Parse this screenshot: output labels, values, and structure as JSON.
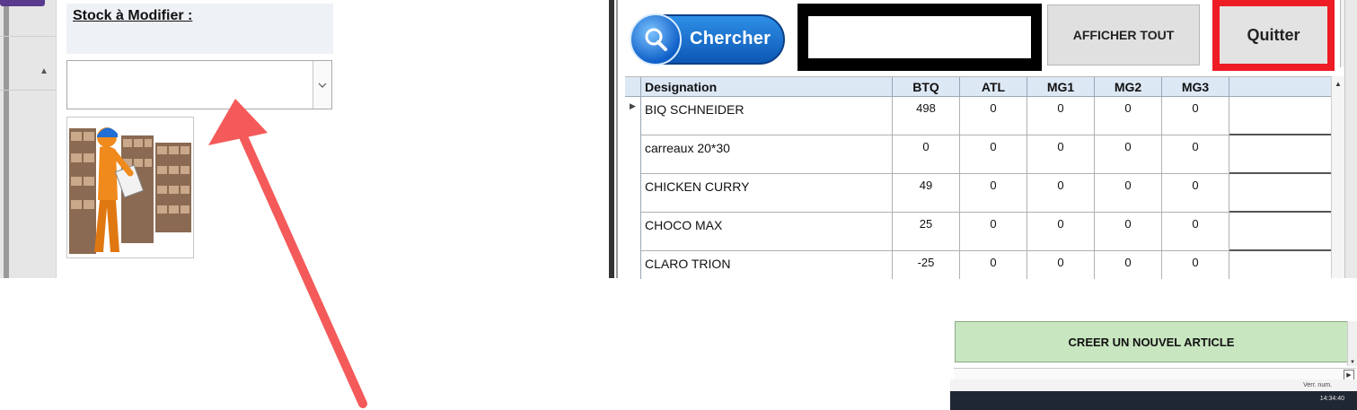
{
  "left_panel": {
    "stock_label": "Stock à Modifier :",
    "combo_value": "",
    "image_icon": "warehouse-worker-clipboard-image"
  },
  "toolbar": {
    "search_label": "Chercher",
    "search_icon": "magnifier-icon",
    "search_value": "",
    "show_all_label": "AFFICHER TOUT",
    "quit_label": "Quitter",
    "accent_blue": "#0d57b5",
    "quit_border": "#ee1c24"
  },
  "grid": {
    "columns": [
      "Designation",
      "BTQ",
      "ATL",
      "MG1",
      "MG2",
      "MG3"
    ],
    "rows": [
      {
        "designation": "BIQ SCHNEIDER",
        "btq": "498",
        "atl": "0",
        "mg1": "0",
        "mg2": "0",
        "mg3": "0"
      },
      {
        "designation": "carreaux 20*30",
        "btq": "0",
        "atl": "0",
        "mg1": "0",
        "mg2": "0",
        "mg3": "0"
      },
      {
        "designation": "CHICKEN CURRY",
        "btq": "49",
        "atl": "0",
        "mg1": "0",
        "mg2": "0",
        "mg3": "0"
      },
      {
        "designation": "CHOCO MAX",
        "btq": "25",
        "atl": "0",
        "mg1": "0",
        "mg2": "0",
        "mg3": "0"
      },
      {
        "designation": "CLARO TRION",
        "btq": "-25",
        "atl": "0",
        "mg1": "0",
        "mg2": "0",
        "mg3": "0"
      }
    ],
    "header_bg": "#dde8f5"
  },
  "bottom": {
    "new_article_label": "CREER UN NOUVEL ARTICLE",
    "status_text": "Verr. num.",
    "clock": "14:34:40",
    "new_button_bg": "#c8e6c0"
  },
  "annotation": {
    "arrow_color": "#f45a5a"
  }
}
